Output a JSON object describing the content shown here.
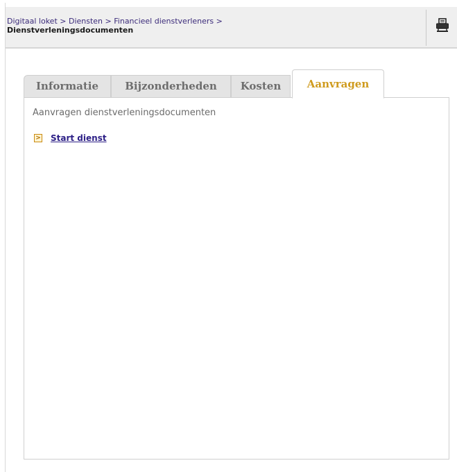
{
  "breadcrumb": {
    "items": [
      "Digitaal loket",
      "Diensten",
      "Financieel dienstverleners"
    ],
    "separator": ">",
    "current": "Dienstverleningsdocumenten"
  },
  "toolbar": {
    "print_icon": "printer-icon"
  },
  "tabs": [
    {
      "label": "Informatie",
      "active": false
    },
    {
      "label": "Bijzonderheden",
      "active": false
    },
    {
      "label": "Kosten",
      "active": false
    },
    {
      "label": "Aanvragen",
      "active": true
    }
  ],
  "panel": {
    "title": "Aanvragen dienstverleningsdocumenten",
    "action": {
      "label": "Start dienst",
      "icon": "arrow-right-icon"
    }
  },
  "colors": {
    "active_tab": "#cf9b1e",
    "link": "#2c1f86",
    "breadcrumb": "#3b2b7a"
  }
}
